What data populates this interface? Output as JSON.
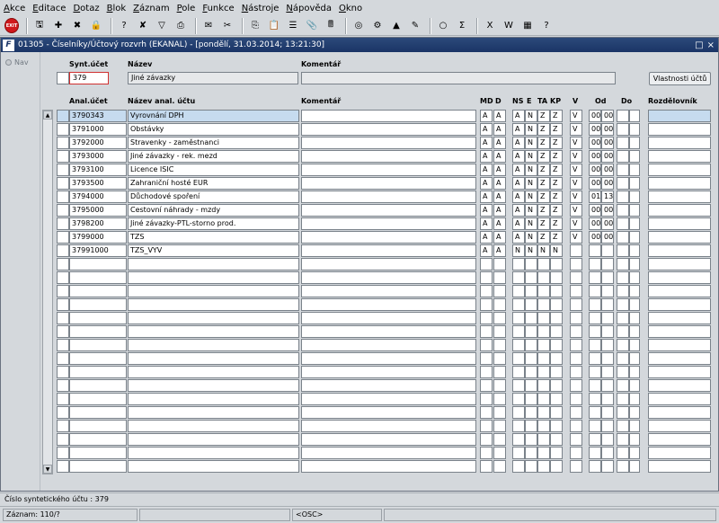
{
  "menu": [
    "Akce",
    "Editace",
    "Dotaz",
    "Blok",
    "Záznam",
    "Pole",
    "Funkce",
    "Nástroje",
    "Nápověda",
    "Okno"
  ],
  "toolbar": {
    "exit_label": "EXIT",
    "icons": [
      "save-icon",
      "add-record-icon",
      "delete-record-icon",
      "lock-icon",
      "query-icon",
      "clear-query-icon",
      "filter-icon",
      "print-icon",
      "mail-icon",
      "cut-icon",
      "copy-icon",
      "paste-icon",
      "list-icon",
      "attach-icon",
      "calculator-icon",
      "globe-icon",
      "settings-icon",
      "chart-icon",
      "edit-icon",
      "info-icon",
      "sum-icon",
      "excel-icon",
      "word-icon",
      "calendar-icon",
      "help-icon"
    ]
  },
  "window": {
    "title": "01305 - Číselníky/Účtový rozvrh (EKANAL) - [pondělí, 31.03.2014; 13:21:30]",
    "app_icon": "F",
    "restore_symbol": "□",
    "close_symbol": "×"
  },
  "nav": {
    "label": "Nav"
  },
  "header": {
    "synt_label": "Synt.účet",
    "synt_value": "379",
    "nazev_label": "Název",
    "nazev_value": "Jiné závazky",
    "komentar_label": "Komentář",
    "komentar_value": "",
    "properties_button": "Vlastnosti účtů"
  },
  "columns": {
    "anal": "Anal.účet",
    "name": "Název anal. účtu",
    "comment": "Komentář",
    "md": "MD",
    "d": "D",
    "ns": "NS",
    "e": "E",
    "ta": "TA",
    "kp": "KP",
    "v": "V",
    "od": "Od",
    "do": "Do",
    "rozd": "Rozdělovník"
  },
  "rows": [
    {
      "acc": "3790343",
      "name": "Vyrovnání DPH",
      "md": "A",
      "d": "A",
      "ns": "A",
      "e": "N",
      "ta": "Z",
      "kp": "Z",
      "v": "V",
      "od1": "00",
      "od2": "00"
    },
    {
      "acc": "3791000",
      "name": "Obstávky",
      "md": "A",
      "d": "A",
      "ns": "A",
      "e": "N",
      "ta": "Z",
      "kp": "Z",
      "v": "V",
      "od1": "00",
      "od2": "00"
    },
    {
      "acc": "3792000",
      "name": "Stravenky - zaměstnanci",
      "md": "A",
      "d": "A",
      "ns": "A",
      "e": "N",
      "ta": "Z",
      "kp": "Z",
      "v": "V",
      "od1": "00",
      "od2": "00"
    },
    {
      "acc": "3793000",
      "name": "Jiné závazky - rek. mezd",
      "md": "A",
      "d": "A",
      "ns": "A",
      "e": "N",
      "ta": "Z",
      "kp": "Z",
      "v": "V",
      "od1": "00",
      "od2": "00"
    },
    {
      "acc": "3793100",
      "name": "Licence ISIC",
      "md": "A",
      "d": "A",
      "ns": "A",
      "e": "N",
      "ta": "Z",
      "kp": "Z",
      "v": "V",
      "od1": "00",
      "od2": "00"
    },
    {
      "acc": "3793500",
      "name": "Zahraniční hosté EUR",
      "md": "A",
      "d": "A",
      "ns": "A",
      "e": "N",
      "ta": "Z",
      "kp": "Z",
      "v": "V",
      "od1": "00",
      "od2": "00"
    },
    {
      "acc": "3794000",
      "name": "Důchodové spoření",
      "md": "A",
      "d": "A",
      "ns": "A",
      "e": "N",
      "ta": "Z",
      "kp": "Z",
      "v": "V",
      "od1": "01",
      "od2": "13"
    },
    {
      "acc": "3795000",
      "name": "Cestovní náhrady - mzdy",
      "md": "A",
      "d": "A",
      "ns": "A",
      "e": "N",
      "ta": "Z",
      "kp": "Z",
      "v": "V",
      "od1": "00",
      "od2": "00"
    },
    {
      "acc": "3798200",
      "name": "Jiné závazky-PTL-storno prod.",
      "md": "A",
      "d": "A",
      "ns": "A",
      "e": "N",
      "ta": "Z",
      "kp": "Z",
      "v": "V",
      "od1": "00",
      "od2": "00"
    },
    {
      "acc": "3799000",
      "name": "TZS",
      "md": "A",
      "d": "A",
      "ns": "A",
      "e": "N",
      "ta": "Z",
      "kp": "Z",
      "v": "V",
      "od1": "00",
      "od2": "00"
    },
    {
      "acc": "37991000",
      "name": "TZS_VYV",
      "md": "A",
      "d": "A",
      "ns": "N",
      "e": "N",
      "ta": "N",
      "kp": "N",
      "v": "",
      "od1": "",
      "od2": ""
    }
  ],
  "scrollbar": {
    "up": "▲",
    "down": "▼"
  },
  "status": {
    "hint": "Číslo syntetického účtu : 379",
    "record": "Záznam: 110/?",
    "osc": "<OSC>"
  }
}
